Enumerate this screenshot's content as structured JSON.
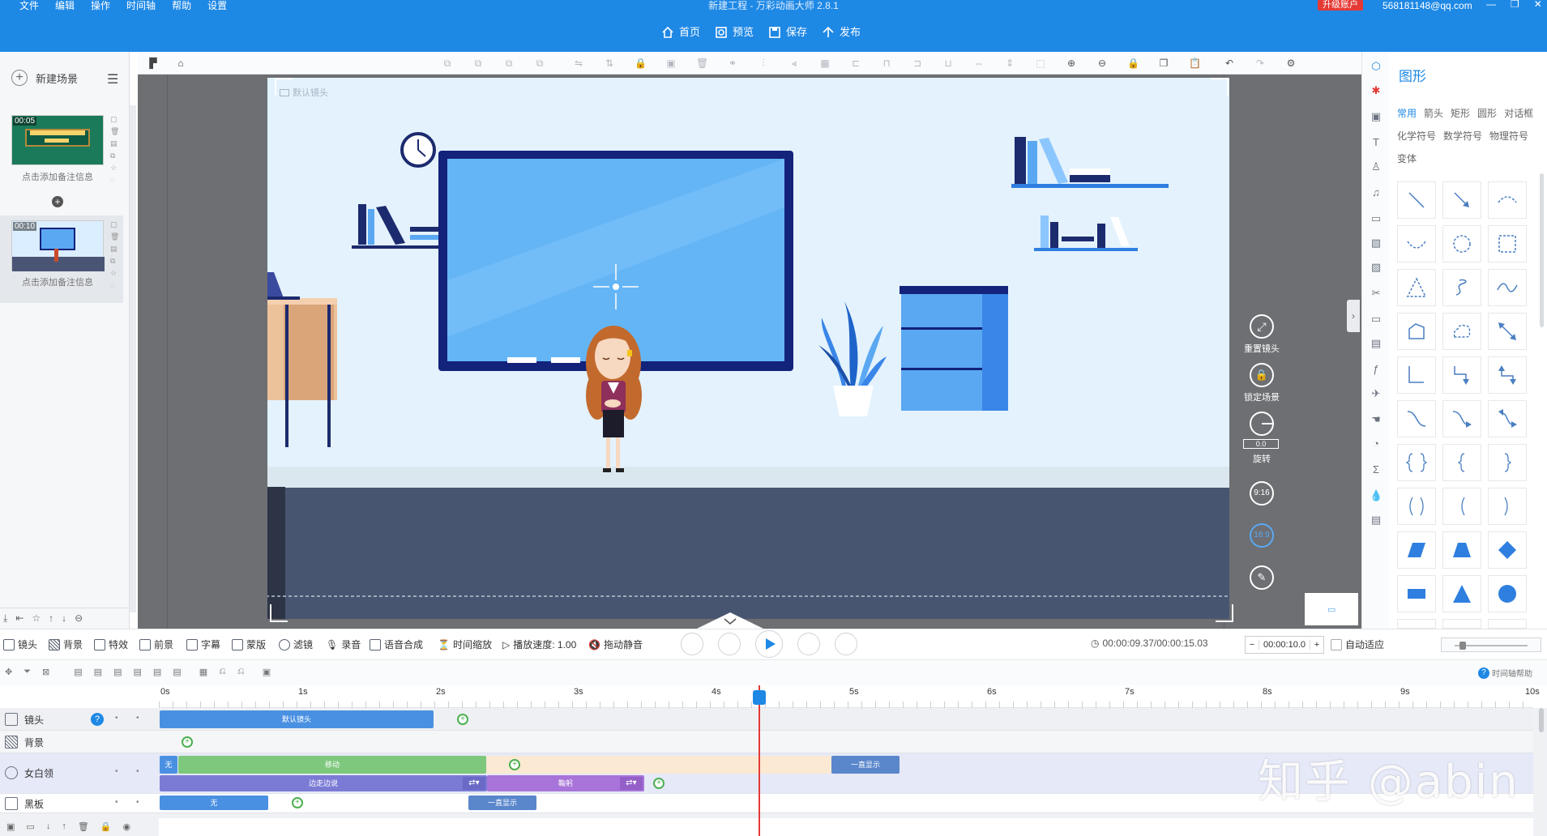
{
  "window": {
    "title": "新建工程 - 万彩动画大师 2.8.1",
    "menu": [
      "文件",
      "编辑",
      "操作",
      "时间轴",
      "帮助",
      "设置"
    ],
    "upgrade": "升级账户",
    "account": "568181148@qq.com"
  },
  "nav": {
    "home": "首页",
    "preview": "预览",
    "save": "保存",
    "publish": "发布"
  },
  "left_panel": {
    "new_scene": "新建场景",
    "scenes": [
      {
        "time": "00:05",
        "note": "点击添加备注信息"
      },
      {
        "time": "00:10",
        "note": "点击添加备注信息"
      }
    ]
  },
  "canvas": {
    "camera_label": "默认镜头",
    "controls": {
      "reset": "重置镜头",
      "lock": "锁定场景",
      "rotate": "旋转",
      "rotate_value": "0.0",
      "ratio_916": "9:16",
      "ratio_169": "16:9"
    }
  },
  "right_panel": {
    "title": "图形",
    "tabs": [
      "常用",
      "箭头",
      "矩形",
      "圆形",
      "对话框",
      "化学符号",
      "数学符号",
      "物理符号",
      "变体"
    ],
    "active_tab": "常用"
  },
  "bottom_toolbar": {
    "items": [
      "镜头",
      "背景",
      "特效",
      "前景",
      "字幕",
      "蒙版",
      "滤镜",
      "录音",
      "语音合成",
      "时间缩放",
      "播放速度: 1.00",
      "拖动静音"
    ],
    "time": "00:00:09.37/00:00:15.03",
    "duration": "00:00:10.0",
    "auto_fit": "自动适应",
    "help": "时间轴帮助"
  },
  "timeline": {
    "ticks": [
      "0s",
      "1s",
      "2s",
      "3s",
      "4s",
      "5s",
      "6s",
      "7s",
      "8s",
      "9s",
      "10s"
    ],
    "tracks": [
      {
        "name": "镜头",
        "bars": [
          {
            "label": "默认镜头"
          }
        ]
      },
      {
        "name": "背景",
        "bars": []
      },
      {
        "name": "女白领",
        "bars": [
          {
            "label": "无"
          },
          {
            "label": "移动"
          },
          {
            "label": "一直显示"
          },
          {
            "label": "边走边说"
          },
          {
            "label": "鞠躬"
          }
        ]
      },
      {
        "name": "黑板",
        "bars": [
          {
            "label": "无"
          },
          {
            "label": "一直显示"
          }
        ]
      }
    ],
    "playhead_time": 4.35
  },
  "watermark": "知乎 @abin"
}
